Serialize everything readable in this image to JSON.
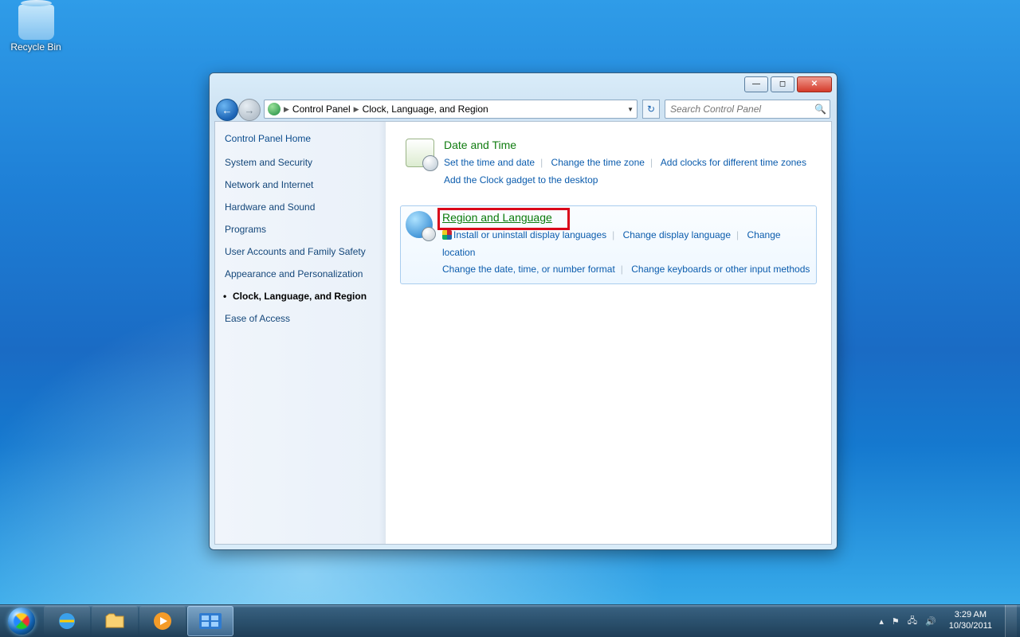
{
  "desktop": {
    "recycle_bin": "Recycle Bin"
  },
  "window": {
    "breadcrumb": {
      "root": "Control Panel",
      "current": "Clock, Language, and Region"
    },
    "search_placeholder": "Search Control Panel"
  },
  "sidebar": {
    "home": "Control Panel Home",
    "items": [
      "System and Security",
      "Network and Internet",
      "Hardware and Sound",
      "Programs",
      "User Accounts and Family Safety",
      "Appearance and Personalization",
      "Clock, Language, and Region",
      "Ease of Access"
    ],
    "active_index": 6
  },
  "categories": [
    {
      "title": "Date and Time",
      "tasks": [
        "Set the time and date",
        "Change the time zone",
        "Add clocks for different time zones",
        "Add the Clock gadget to the desktop"
      ]
    },
    {
      "title": "Region and Language",
      "tasks": [
        "Install or uninstall display languages",
        "Change display language",
        "Change location",
        "Change the date, time, or number format",
        "Change keyboards or other input methods"
      ]
    }
  ],
  "taskbar": {
    "time": "3:29 AM",
    "date": "10/30/2011"
  }
}
